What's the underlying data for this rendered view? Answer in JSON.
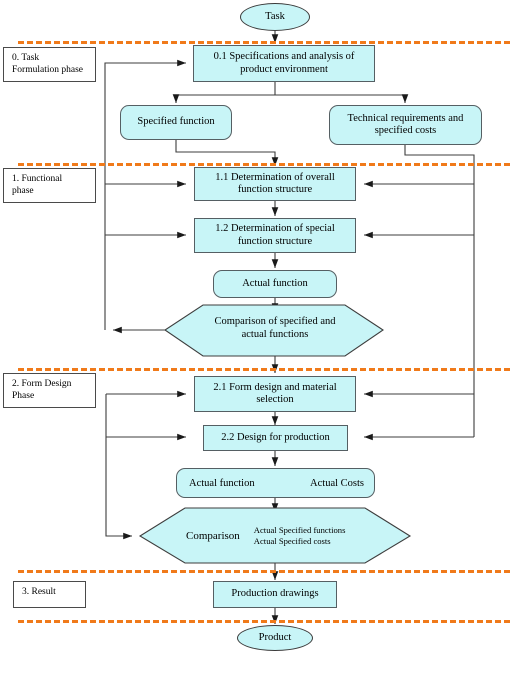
{
  "diagram": {
    "title": "Design process flowchart",
    "colors": {
      "node_fill": "#c8f5f7",
      "node_stroke": "#555f63",
      "separator": "#f07a1a",
      "connector": "#1a1a1a",
      "background": "#ffffff"
    }
  },
  "phases": [
    {
      "id": "phase0",
      "label": "0. Task\nFormulation phase",
      "line1": "0. Task",
      "line2": "Formulation phase"
    },
    {
      "id": "phase1",
      "label": "1.  Functional phase",
      "line1": "1.  Functional",
      "line2": "phase"
    },
    {
      "id": "phase2",
      "label": "2. Form Design Phase",
      "line1": "2. Form Design",
      "line2": "Phase"
    },
    {
      "id": "phase3",
      "label": "3. Result",
      "line1": "3. Result",
      "line2": ""
    }
  ],
  "nodes": {
    "task": {
      "label": "Task",
      "shape": "ellipse"
    },
    "spec_analysis": {
      "label": "0.1  Specifications and analysis of product environment",
      "line1": "0.1  Specifications and analysis of",
      "line2": "product environment",
      "shape": "rect"
    },
    "specified_function": {
      "label": "Specified function",
      "shape": "rounded"
    },
    "technical_requirements": {
      "label": "Technical requirements and specified costs",
      "line1": "Technical requirements and",
      "line2": "specified costs",
      "shape": "rounded"
    },
    "overall_function": {
      "label": "1.1  Determination of overall function structure",
      "line1": "1.1  Determination of overall",
      "line2": "function structure",
      "shape": "rect"
    },
    "special_function": {
      "label": "1.2  Determination of special function structure",
      "line1": "1.2  Determination of special",
      "line2": "function structure",
      "shape": "rect"
    },
    "actual_function_1": {
      "label": "Actual function",
      "shape": "rounded"
    },
    "comparison_1": {
      "label": "Comparison of specified and actual functions",
      "line1": "Comparison of specified and",
      "line2": "actual functions",
      "shape": "hexagon"
    },
    "form_design": {
      "label": "2.1  Form design and material selection",
      "line1": "2.1  Form design and material",
      "line2": "selection",
      "shape": "rect"
    },
    "design_production": {
      "label": "2.2  Design for production",
      "shape": "rect"
    },
    "actual_function_costs": {
      "label_left": "Actual function",
      "label_right": "Actual Costs",
      "shape": "rounded"
    },
    "comparison_2": {
      "title": "Comparison",
      "line1": "Actual Specified functions",
      "line2": "Actual Specified costs",
      "shape": "hexagon"
    },
    "production_drawings": {
      "label": "Production drawings",
      "shape": "rect"
    },
    "product": {
      "label": "Product",
      "shape": "ellipse"
    }
  }
}
